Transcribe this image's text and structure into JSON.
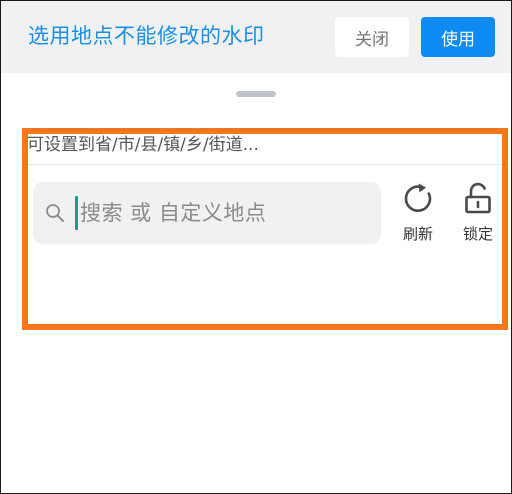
{
  "header": {
    "title": "选用地点不能修改的水印",
    "close_label": "关闭",
    "use_label": "使用"
  },
  "location_panel": {
    "hint": "可设置到省/市/县/镇/乡/街道...",
    "search": {
      "value": "",
      "placeholder": "搜索 或 自定义地点",
      "icon": "search-icon"
    },
    "refresh": {
      "label": "刷新",
      "icon": "refresh-icon"
    },
    "lock": {
      "label": "锁定",
      "icon": "unlock-icon"
    }
  },
  "colors": {
    "accent": "#0d8bf2",
    "title": "#1a8fe3",
    "highlight_border": "#f4761f",
    "caret": "#12a187",
    "header_bg": "#f1f1f3"
  }
}
